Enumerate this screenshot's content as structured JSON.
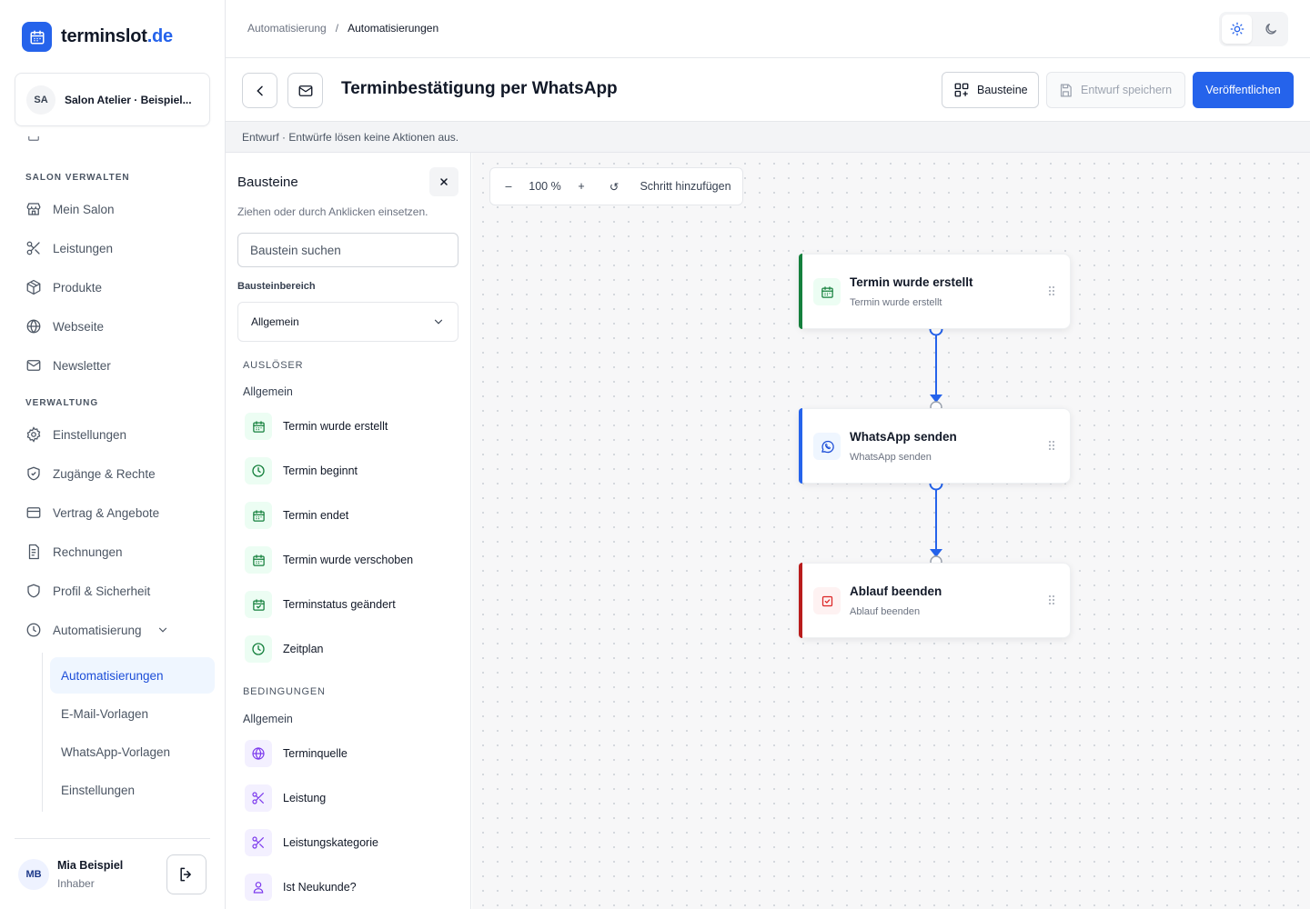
{
  "app": {
    "logo_name": "terminslot",
    "logo_tld": ".de"
  },
  "salon": {
    "initials": "SA",
    "name": "Salon Atelier · Beispiel..."
  },
  "sidebar": {
    "section1": "SALON VERWALTEN",
    "section2": "VERWALTUNG",
    "items": [
      {
        "label": "Mein Salon",
        "icon": "store-icon"
      },
      {
        "label": "Leistungen",
        "icon": "scissors-icon"
      },
      {
        "label": "Produkte",
        "icon": "package-icon"
      },
      {
        "label": "Webseite",
        "icon": "globe-icon"
      },
      {
        "label": "Newsletter",
        "icon": "mail-icon"
      },
      {
        "label": "Einstellungen",
        "icon": "gear-icon"
      },
      {
        "label": "Zugänge & Rechte",
        "icon": "shield-icon"
      },
      {
        "label": "Vertrag & Angebote",
        "icon": "card-icon"
      },
      {
        "label": "Rechnungen",
        "icon": "receipt-icon"
      },
      {
        "label": "Profil & Sicherheit",
        "icon": "shield-check-icon"
      },
      {
        "label": "Automatisierung",
        "icon": "clock-icon"
      }
    ],
    "subitems": [
      {
        "label": "Automatisierungen",
        "active": true
      },
      {
        "label": "E-Mail-Vorlagen"
      },
      {
        "label": "WhatsApp-Vorlagen"
      },
      {
        "label": "Einstellungen"
      }
    ]
  },
  "user": {
    "initials": "MB",
    "name": "Mia Beispiel",
    "role": "Inhaber"
  },
  "breadcrumb": {
    "parent": "Automatisierung",
    "sep": "/",
    "current": "Automatisierungen"
  },
  "editor": {
    "title": "Terminbestätigung per WhatsApp",
    "bausteine_label": "Bausteine",
    "save_label": "Entwurf speichern",
    "publish_label": "Veröffentlichen",
    "draft_note": "Entwurf · Entwürfe lösen keine Aktionen aus."
  },
  "panel": {
    "title": "Bausteine",
    "subtitle": "Ziehen oder durch Anklicken einsetzen.",
    "search_placeholder": "Baustein suchen",
    "area_label": "Bausteinbereich",
    "area_value": "Allgemein",
    "triggers_title": "AUSLÖSER",
    "triggers_sub": "Allgemein",
    "triggers": [
      {
        "label": "Termin wurde erstellt",
        "icon": "calendar-icon"
      },
      {
        "label": "Termin beginnt",
        "icon": "clock-icon"
      },
      {
        "label": "Termin endet",
        "icon": "calendar-icon"
      },
      {
        "label": "Termin wurde verschoben",
        "icon": "calendar-icon"
      },
      {
        "label": "Terminstatus geändert",
        "icon": "calendar-check-icon"
      },
      {
        "label": "Zeitplan",
        "icon": "clock-icon"
      }
    ],
    "conditions_title": "BEDINGUNGEN",
    "conditions_sub": "Allgemein",
    "conditions": [
      {
        "label": "Terminquelle",
        "icon": "globe-icon"
      },
      {
        "label": "Leistung",
        "icon": "scissors-icon"
      },
      {
        "label": "Leistungskategorie",
        "icon": "scissors-icon"
      },
      {
        "label": "Ist Neukunde?",
        "icon": "user-icon"
      }
    ]
  },
  "toolbar": {
    "zoom_out": "–",
    "zoom": "100 %",
    "zoom_in": "+",
    "reset": "↺",
    "add_step": "Schritt hinzufügen"
  },
  "nodes": [
    {
      "title": "Termin wurde erstellt",
      "subtitle": "Termin wurde erstellt",
      "accent": "#15803d",
      "icon": "calendar-icon"
    },
    {
      "title": "WhatsApp senden",
      "subtitle": "WhatsApp senden",
      "accent": "#2563eb",
      "icon": "whatsapp-icon"
    },
    {
      "title": "Ablauf beenden",
      "subtitle": "Ablauf beenden",
      "accent": "#b91c1c",
      "icon": "check-square-icon"
    }
  ],
  "colors": {
    "accent": "#2563eb",
    "trigger": "#15803d",
    "condition": "#7c3aed",
    "end": "#dc2626"
  }
}
